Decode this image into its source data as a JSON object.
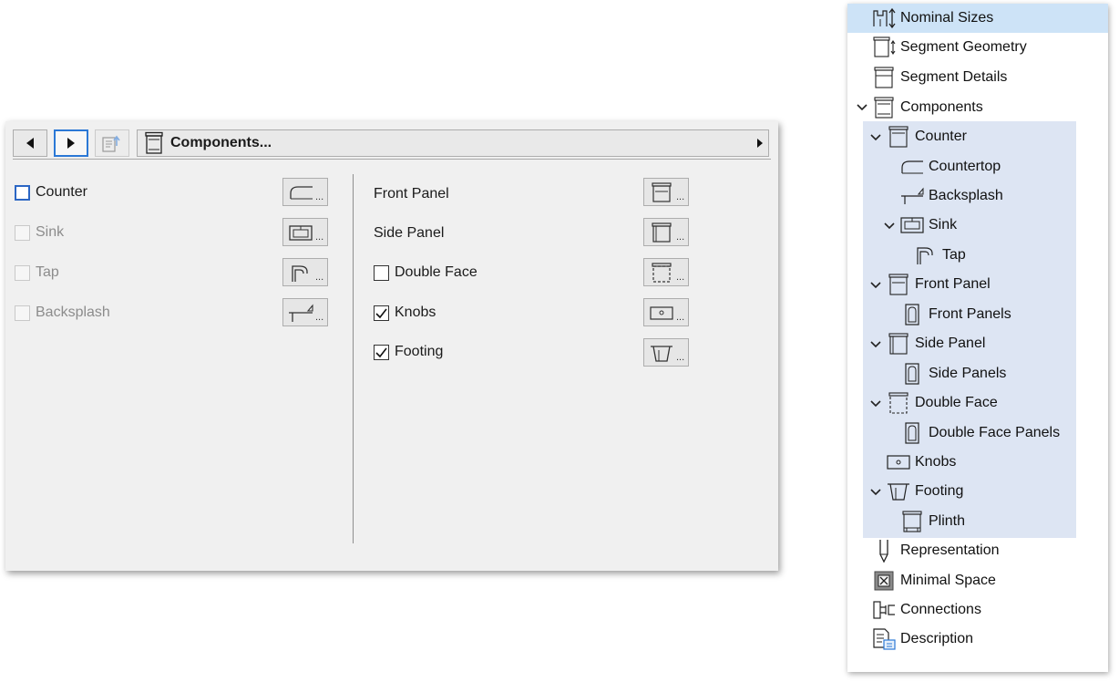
{
  "toolbar": {
    "title": "Components..."
  },
  "left_column": [
    {
      "label": "Counter",
      "checked": false,
      "enabled": true
    },
    {
      "label": "Sink",
      "checked": false,
      "enabled": false
    },
    {
      "label": "Tap",
      "checked": false,
      "enabled": false
    },
    {
      "label": "Backsplash",
      "checked": false,
      "enabled": false
    }
  ],
  "right_column": [
    {
      "label": "Front Panel",
      "has_checkbox": false
    },
    {
      "label": "Side Panel",
      "has_checkbox": false
    },
    {
      "label": "Double Face",
      "has_checkbox": true,
      "checked": false
    },
    {
      "label": "Knobs",
      "has_checkbox": true,
      "checked": true
    },
    {
      "label": "Footing",
      "has_checkbox": true,
      "checked": true
    }
  ],
  "tree": {
    "items": [
      {
        "label": "Nominal Sizes",
        "icon": "nominal-sizes-icon"
      },
      {
        "label": "Segment Geometry",
        "icon": "segment-geometry-icon"
      },
      {
        "label": "Segment Details",
        "icon": "segment-details-icon"
      },
      {
        "label": "Components",
        "icon": "components-icon",
        "expanded": true
      },
      {
        "label": "Counter",
        "icon": "counter-icon",
        "expanded": true
      },
      {
        "label": "Countertop",
        "icon": "countertop-icon"
      },
      {
        "label": "Backsplash",
        "icon": "backsplash-icon"
      },
      {
        "label": "Sink",
        "icon": "sink-icon",
        "expanded": true
      },
      {
        "label": "Tap",
        "icon": "tap-icon"
      },
      {
        "label": "Front Panel",
        "icon": "front-panel-icon",
        "expanded": true
      },
      {
        "label": "Front Panels",
        "icon": "panel-door-icon"
      },
      {
        "label": "Side Panel",
        "icon": "side-panel-icon",
        "expanded": true
      },
      {
        "label": "Side Panels",
        "icon": "panel-door-icon"
      },
      {
        "label": "Double Face",
        "icon": "double-face-icon",
        "expanded": true
      },
      {
        "label": "Double Face Panels",
        "icon": "panel-door-icon"
      },
      {
        "label": "Knobs",
        "icon": "knobs-icon"
      },
      {
        "label": "Footing",
        "icon": "footing-icon",
        "expanded": true
      },
      {
        "label": "Plinth",
        "icon": "plinth-icon"
      },
      {
        "label": "Representation",
        "icon": "representation-icon"
      },
      {
        "label": "Minimal Space",
        "icon": "minimal-space-icon"
      },
      {
        "label": "Connections",
        "icon": "connections-icon"
      },
      {
        "label": "Description",
        "icon": "description-icon"
      }
    ]
  }
}
